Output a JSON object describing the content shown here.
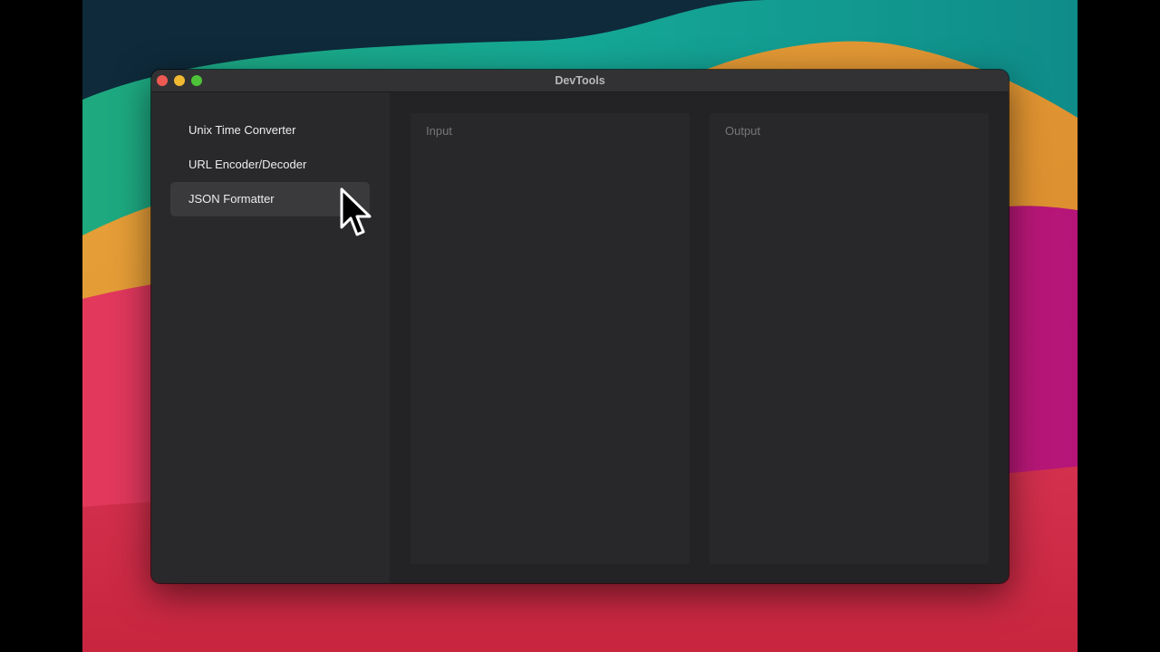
{
  "window": {
    "title": "DevTools"
  },
  "sidebar": {
    "items": [
      {
        "label": "Unix Time Converter",
        "selected": false
      },
      {
        "label": "URL Encoder/Decoder",
        "selected": false
      },
      {
        "label": "JSON Formatter",
        "selected": true
      }
    ]
  },
  "panes": {
    "input_placeholder": "Input",
    "output_placeholder": "Output"
  },
  "colors": {
    "close": "#ee5a52",
    "minimize": "#f2b932",
    "maximize": "#4ec33a",
    "sidebar_selected": "#3a3a3d"
  },
  "icons": {
    "pointer": "mouse-pointer-icon"
  }
}
